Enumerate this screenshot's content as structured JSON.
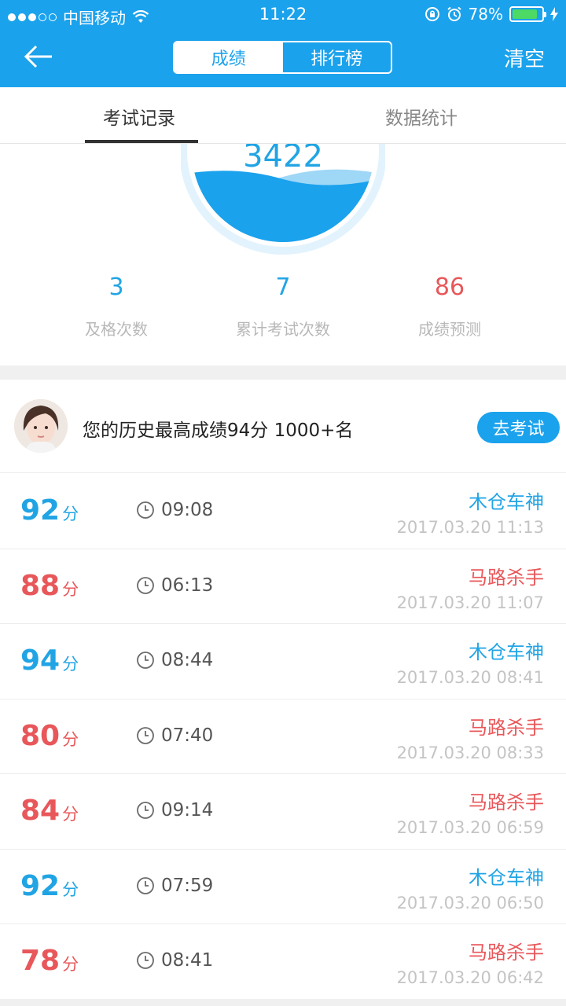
{
  "status_bar": {
    "carrier": "中国移动",
    "time": "11:22",
    "battery": "78%",
    "battery_level": 0.78,
    "signal_icon": "signal-dots-icon",
    "wifi_icon": "wifi-icon"
  },
  "nav": {
    "back_icon": "back-arrow-icon",
    "segments": [
      "成绩",
      "排行榜"
    ],
    "active_segment": 0,
    "clear_label": "清空"
  },
  "tabs": [
    "考试记录",
    "数据统计"
  ],
  "stats": {
    "total": "3422",
    "items": [
      {
        "value": "3",
        "label": "及格次数",
        "color": "#21a4e4"
      },
      {
        "value": "7",
        "label": "累计考试次数",
        "color": "#21a4e4"
      },
      {
        "value": "86",
        "label": "成绩预测",
        "color": "#e8575a"
      }
    ]
  },
  "best": {
    "text": "您的历史最高成绩94分 1000+名",
    "button_label": "去考试"
  },
  "records": [
    {
      "score": "92",
      "unit": "分",
      "duration": "09:08",
      "title": "木仓车神",
      "datetime": "2017.03.20 11:13",
      "color": "blue"
    },
    {
      "score": "88",
      "unit": "分",
      "duration": "06:13",
      "title": "马路杀手",
      "datetime": "2017.03.20 11:07",
      "color": "red"
    },
    {
      "score": "94",
      "unit": "分",
      "duration": "08:44",
      "title": "木仓车神",
      "datetime": "2017.03.20 08:41",
      "color": "blue"
    },
    {
      "score": "80",
      "unit": "分",
      "duration": "07:40",
      "title": "马路杀手",
      "datetime": "2017.03.20 08:33",
      "color": "red"
    },
    {
      "score": "84",
      "unit": "分",
      "duration": "09:14",
      "title": "马路杀手",
      "datetime": "2017.03.20 06:59",
      "color": "red"
    },
    {
      "score": "92",
      "unit": "分",
      "duration": "07:59",
      "title": "木仓车神",
      "datetime": "2017.03.20 06:50",
      "color": "blue"
    },
    {
      "score": "78",
      "unit": "分",
      "duration": "08:41",
      "title": "马路杀手",
      "datetime": "2017.03.20 06:42",
      "color": "red"
    }
  ],
  "colors": {
    "brand": "#1ba2ec",
    "pass": "#21a4e4",
    "fail": "#e8575a"
  }
}
